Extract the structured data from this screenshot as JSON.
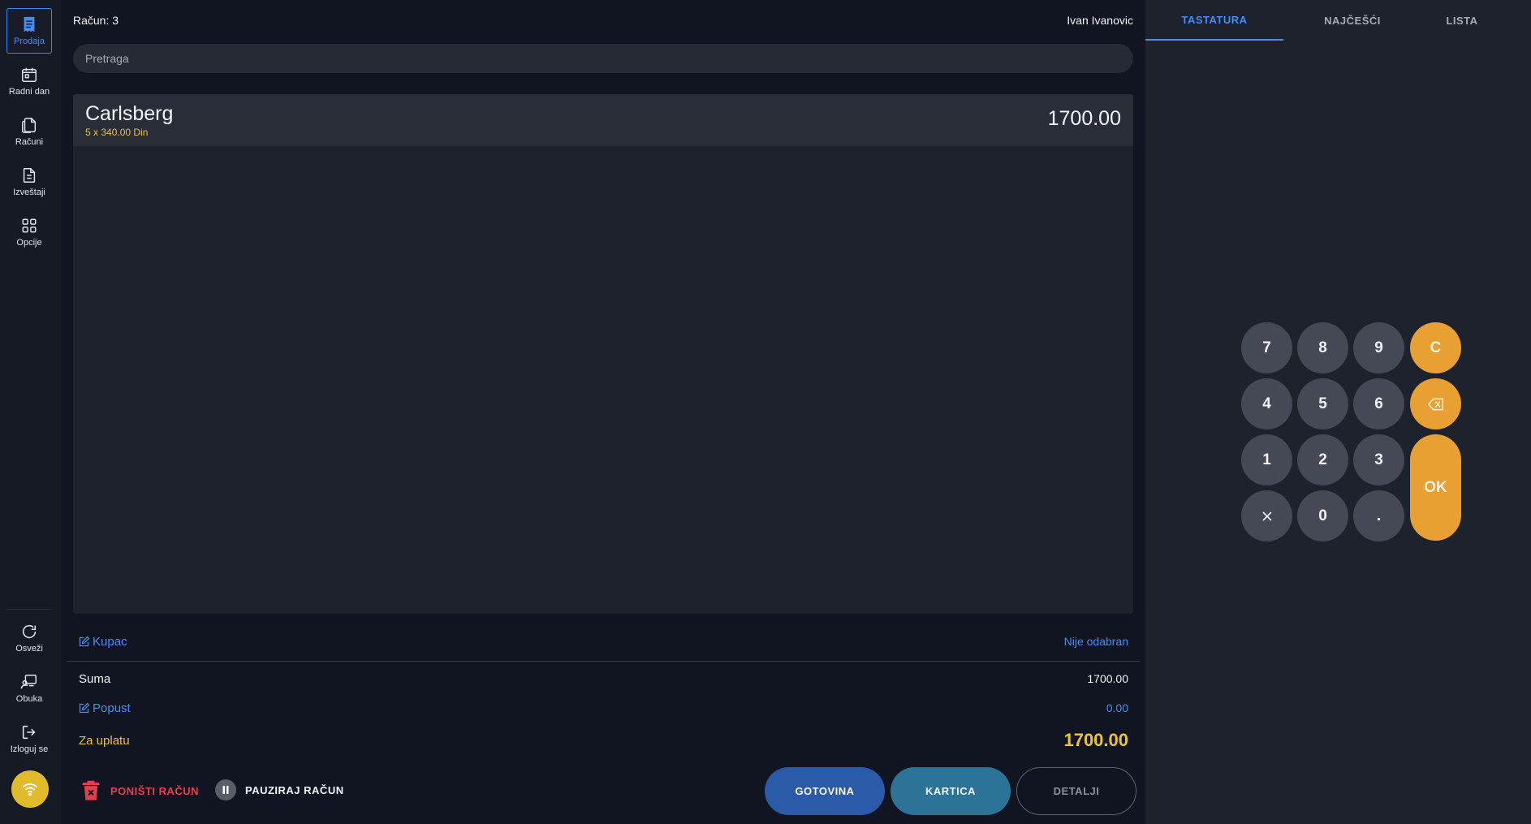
{
  "sidebar": {
    "items": [
      {
        "label": "Prodaja",
        "icon": "receipt-icon",
        "active": true
      },
      {
        "label": "Radni dan",
        "icon": "calendar-icon"
      },
      {
        "label": "Računi",
        "icon": "documents-icon"
      },
      {
        "label": "Izveštaji",
        "icon": "report-icon"
      },
      {
        "label": "Opcije",
        "icon": "grid-icon"
      }
    ],
    "bottom_items": [
      {
        "label": "Osveži",
        "icon": "refresh-icon"
      },
      {
        "label": "Obuka",
        "icon": "training-icon"
      },
      {
        "label": "Izloguj se",
        "icon": "logout-icon"
      }
    ],
    "wifi_icon": "wifi-icon",
    "wifi_color": "#e1bb2a"
  },
  "header": {
    "bill_label": "Račun: 3",
    "user": "Ivan Ivanovic"
  },
  "search": {
    "placeholder": "Pretraga"
  },
  "items": [
    {
      "name": "Carlsberg",
      "detail": "5 x 340.00 Din",
      "total": "1700.00"
    }
  ],
  "summary": {
    "customer_label": "Kupac",
    "customer_value": "Nije odabran",
    "sum_label": "Suma",
    "sum_value": "1700.00",
    "discount_label": "Popust",
    "discount_value": "0.00",
    "pay_label": "Za uplatu",
    "pay_value": "1700.00"
  },
  "actions": {
    "cancel": "PONIŠTI RAČUN",
    "pause": "PAUZIRAJ RAČUN",
    "cash": "GOTOVINA",
    "card": "KARTICA",
    "details": "DETALJI"
  },
  "tabs": [
    {
      "label": "TASTATURA",
      "active": true
    },
    {
      "label": "NAJČEŠĆI"
    },
    {
      "label": "LISTA"
    }
  ],
  "keypad": {
    "k7": "7",
    "k8": "8",
    "k9": "9",
    "clear": "C",
    "k4": "4",
    "k5": "5",
    "k6": "6",
    "k1": "1",
    "k2": "2",
    "k3": "3",
    "ok": "OK",
    "k0": "0",
    "dot": "."
  },
  "colors": {
    "accent": "#4a8bf0",
    "warning": "#e8c53a",
    "orange": "#e8a032",
    "danger": "#e2404c",
    "cash": "#2b5ba8",
    "card": "#2c7398"
  }
}
